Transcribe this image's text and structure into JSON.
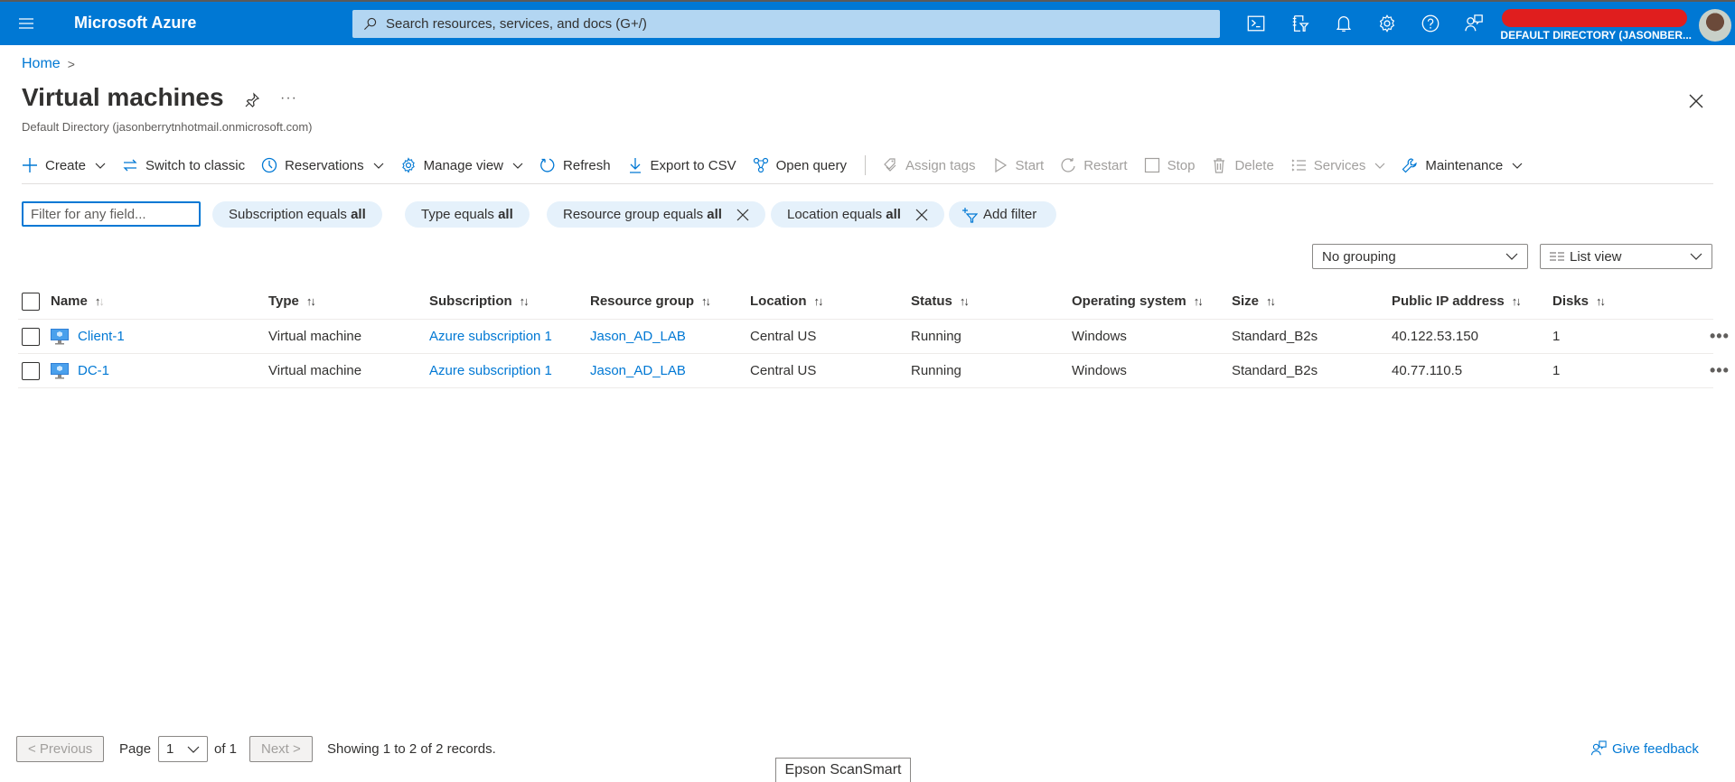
{
  "topbar": {
    "brand": "Microsoft Azure",
    "search_placeholder": "Search resources, services, and docs (G+/)",
    "icons": [
      "cloud-shell-icon",
      "directory-filter-icon",
      "notifications-icon",
      "settings-icon",
      "help-icon",
      "feedback-icon"
    ],
    "account_directory": "DEFAULT DIRECTORY (JASONBER..."
  },
  "breadcrumb": {
    "home": "Home",
    "separator": ">"
  },
  "page": {
    "title": "Virtual machines",
    "subtitle": "Default Directory (jasonberrytnhotmail.onmicrosoft.com)",
    "more": "···"
  },
  "toolbar": {
    "create": "Create",
    "switch_classic": "Switch to classic",
    "reservations": "Reservations",
    "manage_view": "Manage view",
    "refresh": "Refresh",
    "export_csv": "Export to CSV",
    "open_query": "Open query",
    "assign_tags": "Assign tags",
    "start": "Start",
    "restart": "Restart",
    "stop": "Stop",
    "delete": "Delete",
    "services": "Services",
    "maintenance": "Maintenance"
  },
  "filters": {
    "placeholder": "Filter for any field...",
    "pills": [
      {
        "label": "Subscription equals ",
        "value": "all"
      },
      {
        "label": "Type equals ",
        "value": "all"
      },
      {
        "label": "Resource group equals ",
        "value": "all"
      },
      {
        "label": "Location equals ",
        "value": "all"
      }
    ],
    "add_filter": "Add filter"
  },
  "view": {
    "grouping": "No grouping",
    "view_mode": "List view"
  },
  "table": {
    "columns": [
      "Name",
      "Type",
      "Subscription",
      "Resource group",
      "Location",
      "Status",
      "Operating system",
      "Size",
      "Public IP address",
      "Disks"
    ],
    "rows": [
      {
        "name": "Client-1",
        "type": "Virtual machine",
        "subscription": "Azure subscription 1",
        "resource_group": "Jason_AD_LAB",
        "location": "Central US",
        "status": "Running",
        "os": "Windows",
        "size": "Standard_B2s",
        "ip": "40.122.53.150",
        "disks": "1"
      },
      {
        "name": "DC-1",
        "type": "Virtual machine",
        "subscription": "Azure subscription 1",
        "resource_group": "Jason_AD_LAB",
        "location": "Central US",
        "status": "Running",
        "os": "Windows",
        "size": "Standard_B2s",
        "ip": "40.77.110.5",
        "disks": "1"
      }
    ],
    "row_more": "•••"
  },
  "pagination": {
    "previous": "< Previous",
    "page_label": "Page",
    "page_value": "1",
    "of_label": "of 1",
    "next": "Next >",
    "summary": "Showing 1 to 2 of 2 records."
  },
  "feedback": "Give feedback",
  "taskbar_tooltip": "Epson ScanSmart",
  "colors": {
    "accent": "#0078d4",
    "header_bg": "#0078d4",
    "search_bg": "#b3d6f2",
    "pill_bg": "#e5f1fb",
    "redaction": "#e01e1e"
  }
}
